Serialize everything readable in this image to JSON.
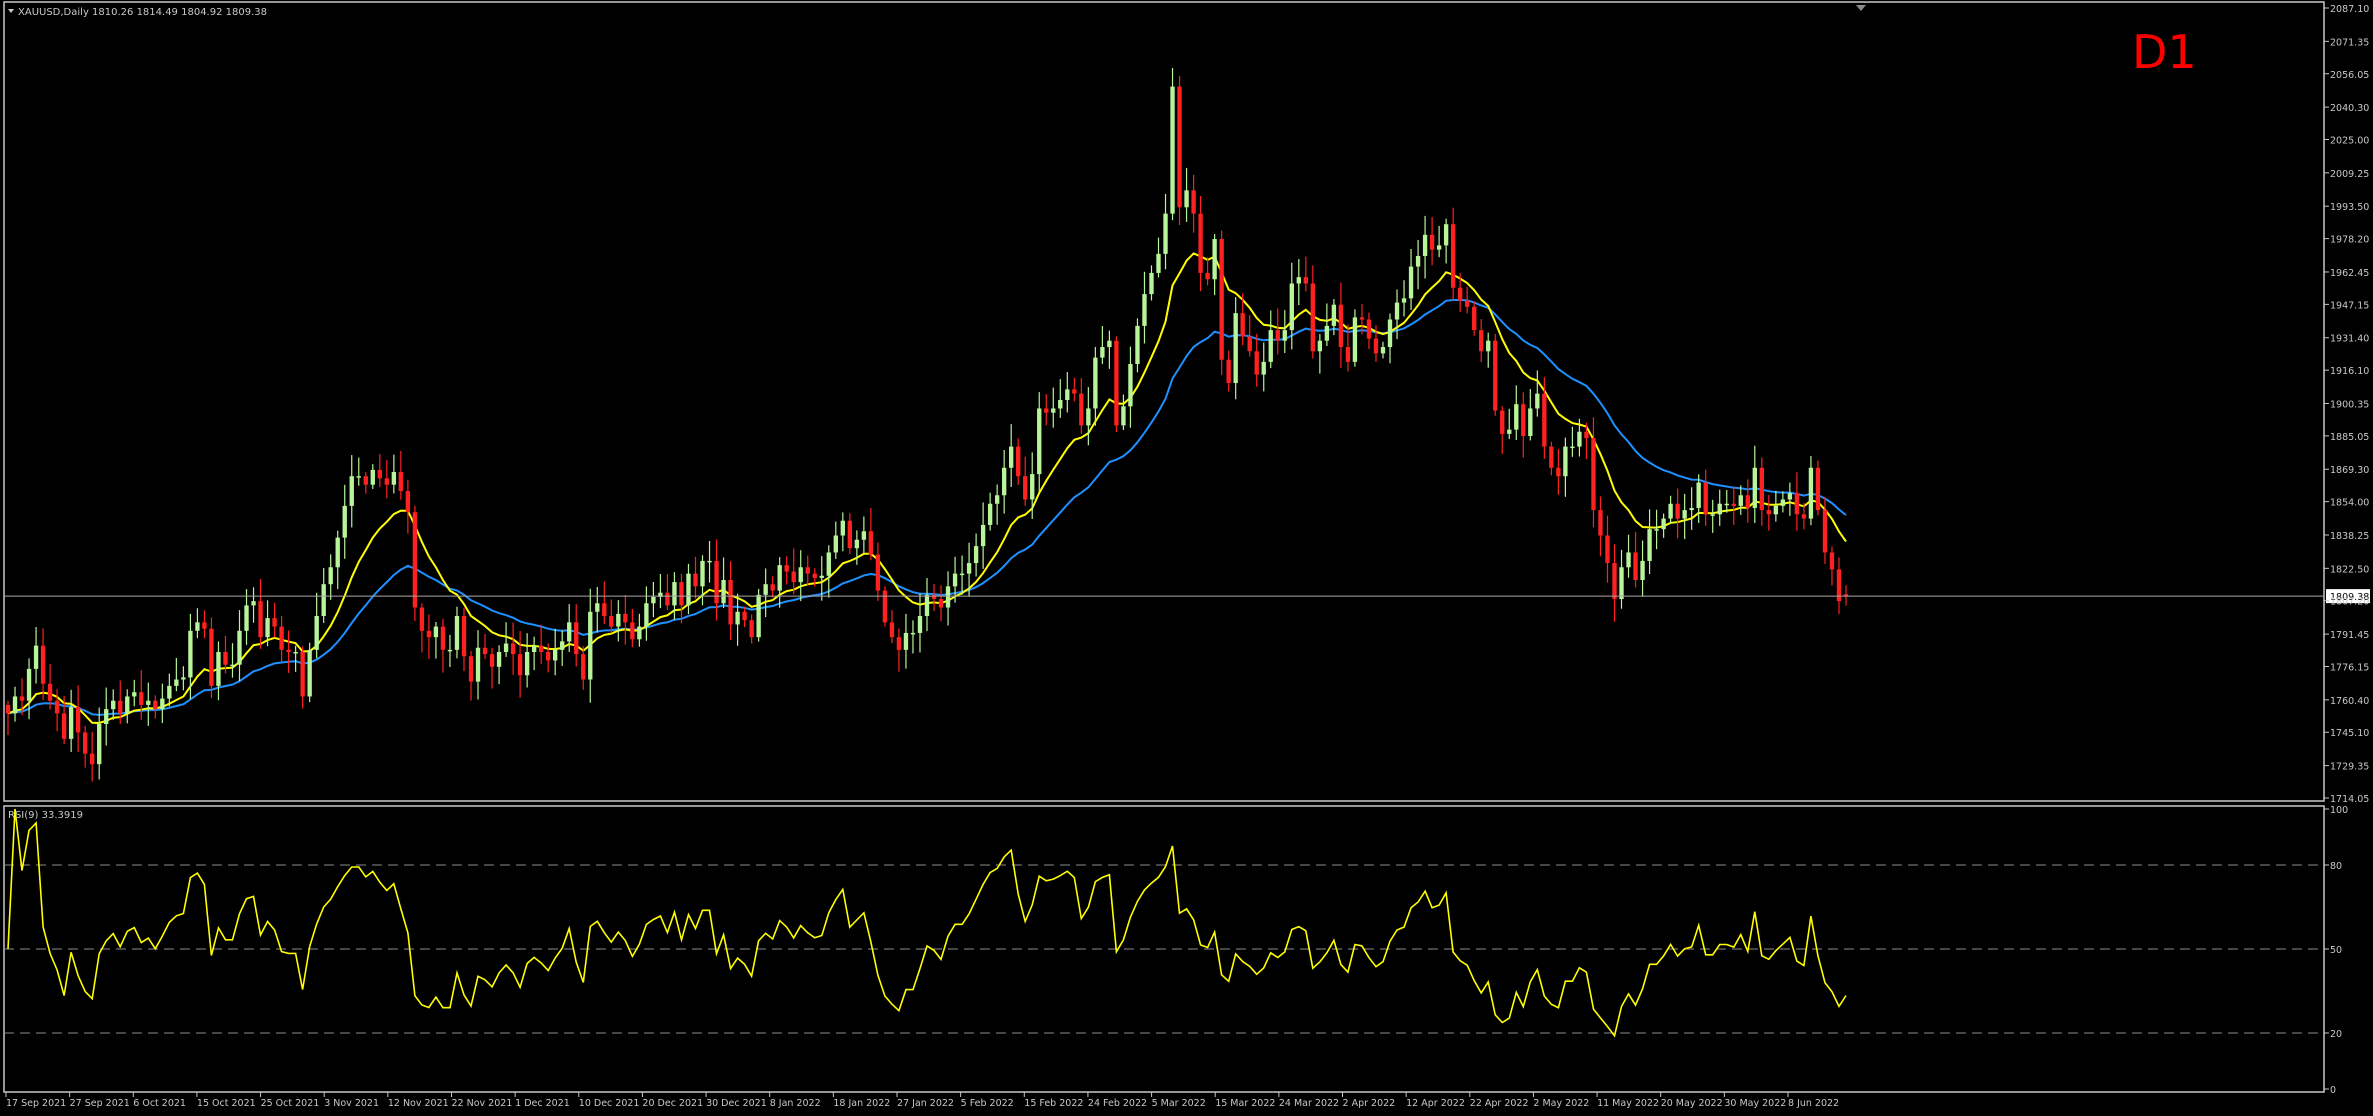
{
  "colors": {
    "background": "#000000",
    "frame": "#c8c8c8",
    "axis_text": "#c8c8c8",
    "bull_candle": "#b8f59a",
    "bear_candle": "#ff2020",
    "ma_fast": "#ffff00",
    "ma_slow": "#1e90ff",
    "rsi": "#ffff00",
    "price_line": "#a9a9a9",
    "rsi_levels": "#8c8c8c",
    "timeframe_label": "#ff0000",
    "price_tag_bg": "#ffffff",
    "price_tag_text": "#000000"
  },
  "header": {
    "symbol_info": "XAUUSD,Daily  1810.26 1814.49 1804.92 1809.38",
    "timeframe": "D1"
  },
  "chart_data": [
    {
      "type": "candlestick",
      "title": "XAUUSD,Daily",
      "ohlc_last": {
        "open": 1810.26,
        "high": 1814.49,
        "low": 1804.92,
        "close": 1809.38
      },
      "current_price_label": "1809.38",
      "ylim": [
        1714.05,
        2087.1
      ],
      "y_ticks": [
        "2087.10",
        "2071.35",
        "2056.05",
        "2040.30",
        "2025.00",
        "2009.25",
        "1993.50",
        "1978.20",
        "1962.45",
        "1947.15",
        "1931.40",
        "1916.10",
        "1900.35",
        "1885.05",
        "1869.30",
        "1854.00",
        "1838.25",
        "1822.50",
        "1807.20",
        "1791.45",
        "1776.15",
        "1760.40",
        "1745.10",
        "1729.35",
        "1714.05"
      ],
      "x_ticks": [
        "17 Sep 2021",
        "27 Sep 2021",
        "6 Oct 2021",
        "15 Oct 2021",
        "25 Oct 2021",
        "3 Nov 2021",
        "12 Nov 2021",
        "22 Nov 2021",
        "1 Dec 2021",
        "10 Dec 2021",
        "20 Dec 2021",
        "30 Dec 2021",
        "8 Jan 2022",
        "18 Jan 2022",
        "27 Jan 2022",
        "5 Feb 2022",
        "15 Feb 2022",
        "24 Feb 2022",
        "5 Mar 2022",
        "15 Mar 2022",
        "24 Mar 2022",
        "2 Apr 2022",
        "12 Apr 2022",
        "22 Apr 2022",
        "2 May 2022",
        "11 May 2022",
        "20 May 2022",
        "30 May 2022",
        "8 Jun 2022"
      ],
      "close": [
        1754,
        1762,
        1760,
        1775,
        1786,
        1768,
        1760,
        1754,
        1742,
        1757,
        1745,
        1735,
        1730,
        1749,
        1756,
        1760,
        1754,
        1762,
        1764,
        1758,
        1760,
        1756,
        1761,
        1767,
        1770,
        1771,
        1793,
        1797,
        1794,
        1767,
        1783,
        1777,
        1777,
        1793,
        1805,
        1807,
        1790,
        1799,
        1795,
        1784,
        1783,
        1783,
        1762,
        1784,
        1800,
        1815,
        1823,
        1837,
        1852,
        1866,
        1866,
        1862,
        1869,
        1865,
        1862,
        1868,
        1859,
        1849,
        1804,
        1793,
        1790,
        1795,
        1784,
        1784,
        1800,
        1781,
        1769,
        1785,
        1782,
        1776,
        1783,
        1787,
        1782,
        1772,
        1783,
        1786,
        1783,
        1779,
        1784,
        1788,
        1797,
        1782,
        1770,
        1802,
        1806,
        1800,
        1795,
        1801,
        1797,
        1789,
        1795,
        1806,
        1809,
        1811,
        1805,
        1816,
        1805,
        1820,
        1814,
        1826,
        1826,
        1806,
        1817,
        1796,
        1802,
        1798,
        1790,
        1810,
        1815,
        1812,
        1824,
        1821,
        1816,
        1823,
        1820,
        1818,
        1819,
        1830,
        1838,
        1845,
        1832,
        1836,
        1840,
        1829,
        1812,
        1797,
        1790,
        1784,
        1792,
        1792,
        1800,
        1810,
        1808,
        1804,
        1814,
        1820,
        1820,
        1825,
        1833,
        1843,
        1853,
        1857,
        1870,
        1880,
        1866,
        1855,
        1867,
        1898,
        1896,
        1898,
        1902,
        1907,
        1905,
        1890,
        1898,
        1922,
        1927,
        1930,
        1890,
        1899,
        1919,
        1937,
        1952,
        1962,
        1971,
        1990,
        2050,
        1993,
        2001,
        1990,
        1962,
        1959,
        1978,
        1921,
        1910,
        1943,
        1932,
        1925,
        1914,
        1920,
        1935,
        1930,
        1935,
        1957,
        1960,
        1957,
        1925,
        1930,
        1937,
        1947,
        1927,
        1920,
        1941,
        1940,
        1931,
        1924,
        1927,
        1940,
        1948,
        1950,
        1965,
        1970,
        1980,
        1973,
        1975,
        1985,
        1955,
        1949,
        1946,
        1935,
        1925,
        1930,
        1897,
        1886,
        1888,
        1900,
        1885,
        1898,
        1905,
        1880,
        1870,
        1866,
        1880,
        1880,
        1887,
        1884,
        1850,
        1838,
        1825,
        1808,
        1823,
        1830,
        1817,
        1826,
        1841,
        1841,
        1846,
        1853,
        1846,
        1850,
        1851,
        1863,
        1848,
        1848,
        1853,
        1853,
        1852,
        1857,
        1851,
        1870,
        1850,
        1848,
        1852,
        1855,
        1858,
        1848,
        1846,
        1870,
        1850,
        1830,
        1822,
        1807,
        1809.38
      ],
      "ma_fast_period_note": "",
      "rsi": {
        "title": "RSI(9) 33.3919",
        "period": 9,
        "last_value": 33.3919,
        "ylim": [
          0,
          100
        ],
        "levels": [
          80,
          50,
          20
        ],
        "y_ticks": [
          "100",
          "80",
          "50",
          "20",
          "0"
        ]
      }
    }
  ]
}
